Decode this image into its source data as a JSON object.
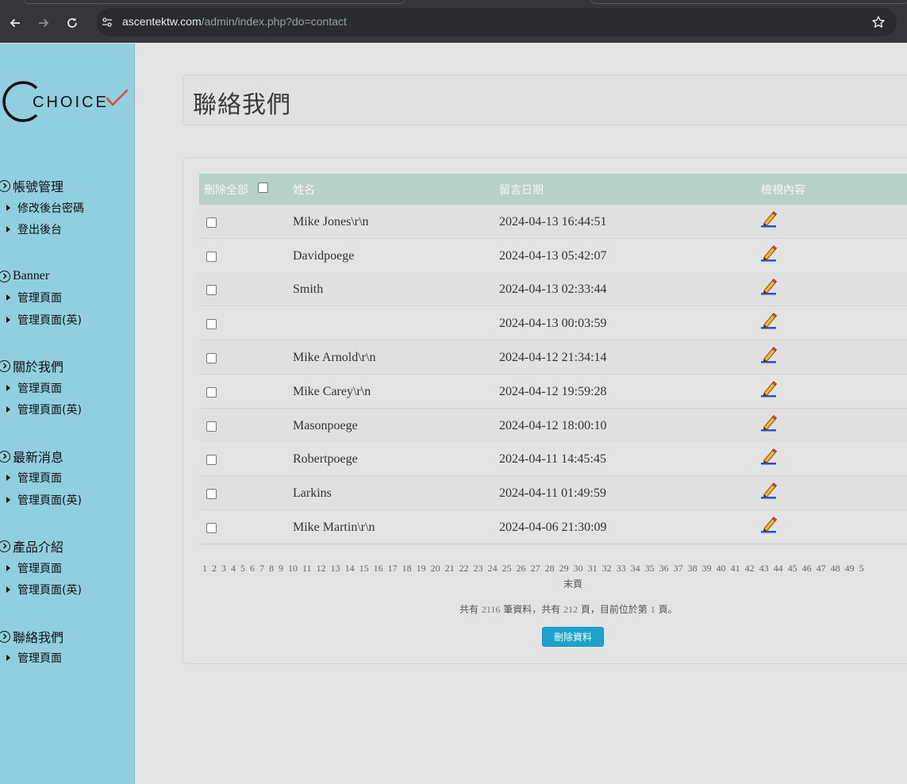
{
  "browser": {
    "url_host": "ascentektw.com",
    "url_path": "/admin/index.php?do=contact"
  },
  "sidebar": {
    "logo_text": "CHOICE",
    "groups": [
      {
        "title": "帳號管理",
        "items": [
          "修改後台密碼",
          "登出後台"
        ]
      },
      {
        "title": "Banner",
        "items": [
          "管理頁面",
          "管理頁面(英)"
        ]
      },
      {
        "title": "關於我們",
        "items": [
          "管理頁面",
          "管理頁面(英)"
        ]
      },
      {
        "title": "最新消息",
        "items": [
          "管理頁面",
          "管理頁面(英)"
        ]
      },
      {
        "title": "產品介紹",
        "items": [
          "管理頁面",
          "管理頁面(英)"
        ]
      },
      {
        "title": "聯絡我們",
        "items": [
          "管理頁面"
        ]
      }
    ]
  },
  "main": {
    "page_title": "聯絡我們",
    "table": {
      "headers": [
        "刪除全部",
        "姓名",
        "留言日期",
        "檢視內容"
      ],
      "rows": [
        {
          "name": "Mike Jones\\r\\n",
          "date": "2024-04-13 16:44:51"
        },
        {
          "name": "Davidpoege",
          "date": "2024-04-13 05:42:07"
        },
        {
          "name": "Smith",
          "date": "2024-04-13 02:33:44"
        },
        {
          "name": "",
          "date": "2024-04-13 00:03:59"
        },
        {
          "name": "Mike Arnold\\r\\n",
          "date": "2024-04-12 21:34:14"
        },
        {
          "name": "Mike Carey\\r\\n",
          "date": "2024-04-12 19:59:28"
        },
        {
          "name": "Masonpoege",
          "date": "2024-04-12 18:00:10"
        },
        {
          "name": "Robertpoege",
          "date": "2024-04-11 14:45:45"
        },
        {
          "name": "Larkins",
          "date": "2024-04-11 01:49:59"
        },
        {
          "name": "Mike Martin\\r\\n",
          "date": "2024-04-06 21:30:09"
        }
      ]
    },
    "pagination": {
      "pages": [
        "1",
        "2",
        "3",
        "4",
        "5",
        "6",
        "7",
        "8",
        "9",
        "10",
        "11",
        "12",
        "13",
        "14",
        "15",
        "16",
        "17",
        "18",
        "19",
        "20",
        "21",
        "22",
        "23",
        "24",
        "25",
        "26",
        "27",
        "28",
        "29",
        "30",
        "31",
        "32",
        "33",
        "34",
        "35",
        "36",
        "37",
        "38",
        "39",
        "40",
        "41",
        "42",
        "43",
        "44",
        "45",
        "46",
        "47",
        "48",
        "49",
        "5"
      ],
      "last_label": "末頁"
    },
    "summary": {
      "prefix": "共有",
      "total_records": "2116",
      "mid1": "筆資料，共有",
      "total_pages": "212",
      "mid2": "頁，目前位於第",
      "current_page": "1",
      "suffix": "頁。"
    },
    "delete_button": "刪除資料"
  },
  "colors": {
    "sidebar_bg": "#8fcfe0",
    "table_header_bg": "#b7d0c8",
    "button_bg": "#1aa3cf",
    "logo_check": "#e8472b"
  }
}
